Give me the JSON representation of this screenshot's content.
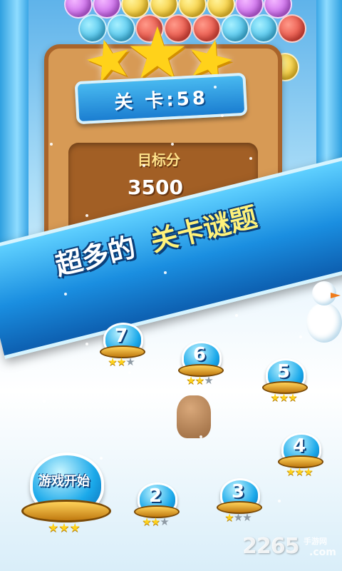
{
  "level_card": {
    "level_label": "关 卡:58",
    "target_label": "目标分",
    "target_score": "3500",
    "stars_earned": 3
  },
  "banner": {
    "text_part1": "超多的",
    "text_part2": "关卡谜题"
  },
  "map": {
    "start_button": {
      "label": "游戏开始",
      "stars": 3
    },
    "levels": [
      {
        "number": "2",
        "stars": 2
      },
      {
        "number": "3",
        "stars": 1
      },
      {
        "number": "4",
        "stars": 3
      },
      {
        "number": "5",
        "stars": 3
      },
      {
        "number": "6",
        "stars": 2
      },
      {
        "number": "7",
        "stars": 2
      }
    ]
  },
  "watermark": {
    "number": "2265",
    "site": "手游网",
    "suffix": ".com"
  }
}
